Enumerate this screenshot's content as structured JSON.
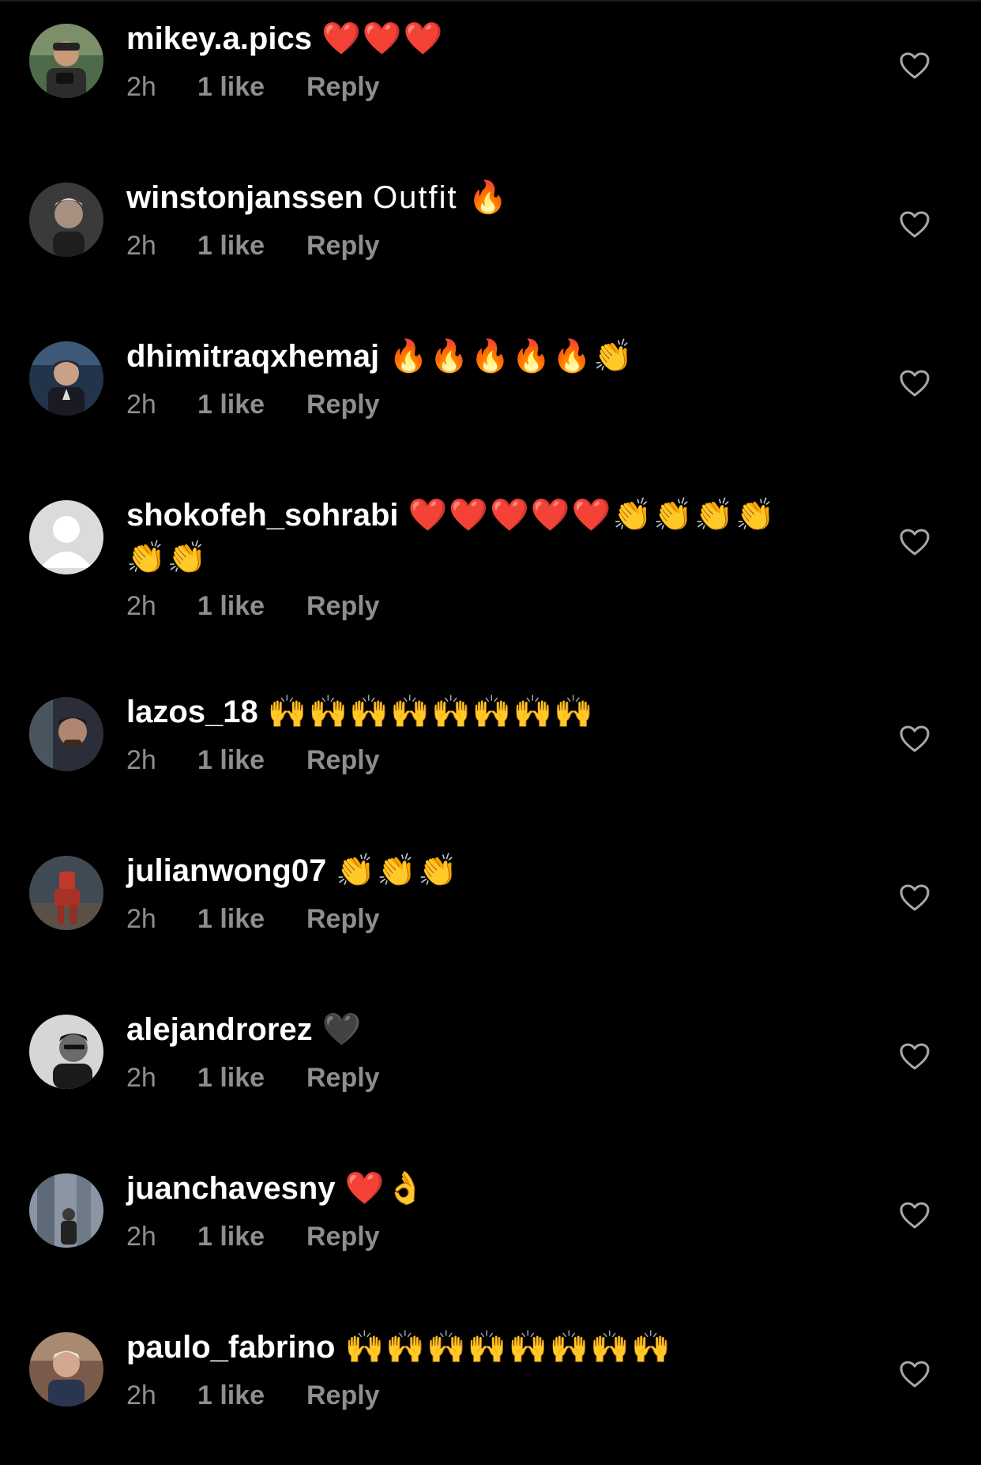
{
  "comments": [
    {
      "username": "mikey.a.pics",
      "text": "❤️❤️❤️",
      "text2": "",
      "time": "2h",
      "likes": "1 like",
      "reply": "Reply",
      "avatar": "avatar-camera"
    },
    {
      "username": "winstonjanssen",
      "text": "Outfit 🔥",
      "text2": "",
      "time": "2h",
      "likes": "1 like",
      "reply": "Reply",
      "avatar": "avatar-gray"
    },
    {
      "username": "dhimitraqxhemaj",
      "text": "🔥🔥🔥🔥🔥👏",
      "text2": "",
      "time": "2h",
      "likes": "1 like",
      "reply": "Reply",
      "avatar": "avatar-blue"
    },
    {
      "username": "shokofeh_sohrabi",
      "text": "❤️❤️❤️❤️❤️👏👏👏👏",
      "text2": "👏👏",
      "time": "2h",
      "likes": "1 like",
      "reply": "Reply",
      "avatar": "avatar-default"
    },
    {
      "username": "lazos_18",
      "text": "🙌🙌🙌🙌🙌🙌🙌🙌",
      "text2": "",
      "time": "2h",
      "likes": "1 like",
      "reply": "Reply",
      "avatar": "avatar-dark"
    },
    {
      "username": "julianwong07",
      "text": "👏👏👏",
      "text2": "",
      "time": "2h",
      "likes": "1 like",
      "reply": "Reply",
      "avatar": "avatar-red"
    },
    {
      "username": "alejandrorez",
      "text": "🖤",
      "text2": "",
      "time": "2h",
      "likes": "1 like",
      "reply": "Reply",
      "avatar": "avatar-bw"
    },
    {
      "username": "juanchavesny",
      "text": "❤️👌",
      "text2": "",
      "time": "2h",
      "likes": "1 like",
      "reply": "Reply",
      "avatar": "avatar-city"
    },
    {
      "username": "paulo_fabrino",
      "text": "🙌🙌🙌🙌🙌🙌🙌🙌",
      "text2": "",
      "time": "2h",
      "likes": "1 like",
      "reply": "Reply",
      "avatar": "avatar-gray-hair"
    }
  ],
  "colors": {
    "background": "#000000",
    "primary_text": "#ffffff",
    "secondary_text": "#8e8e8e",
    "heart_outline": "#a8a8a8"
  },
  "icons": {
    "like": "heart-outline-icon",
    "default_avatar": "person-silhouette-icon"
  }
}
